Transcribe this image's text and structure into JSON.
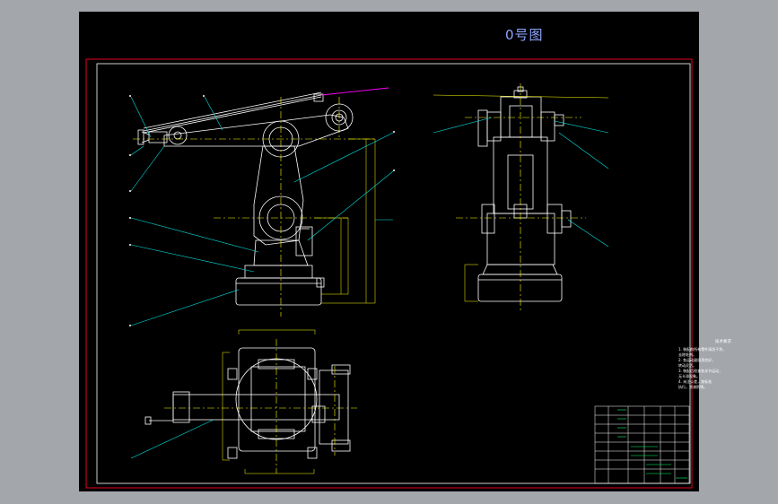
{
  "sheet": {
    "title": "0号图"
  },
  "notes": {
    "title": "技术要求",
    "items": [
      "1. 装配前所有零件清洗干净，",
      "   去除毛刺。",
      "2. 各运动副润滑良好，",
      "   转动灵活。",
      "3. 装配后检查各关节运动，",
      "   无卡滞现象。",
      "4. 未注公差，按标准",
      "   执行，涂漆防锈。"
    ]
  },
  "colors": {
    "background": "#000000",
    "window_chrome": "#a3a7ab",
    "border_outer": "#c0001a",
    "border_inner": "#ffffff",
    "part_lines": "#ffffff",
    "center_lines": "#ffff00",
    "leader_lines": "#00e5e5",
    "dimension_lines": "#ffff00",
    "highlight_line": "#ff00ff",
    "title_block_green": "#00ff66"
  },
  "icons": {
    "balloon": "leader-callout-icon"
  }
}
